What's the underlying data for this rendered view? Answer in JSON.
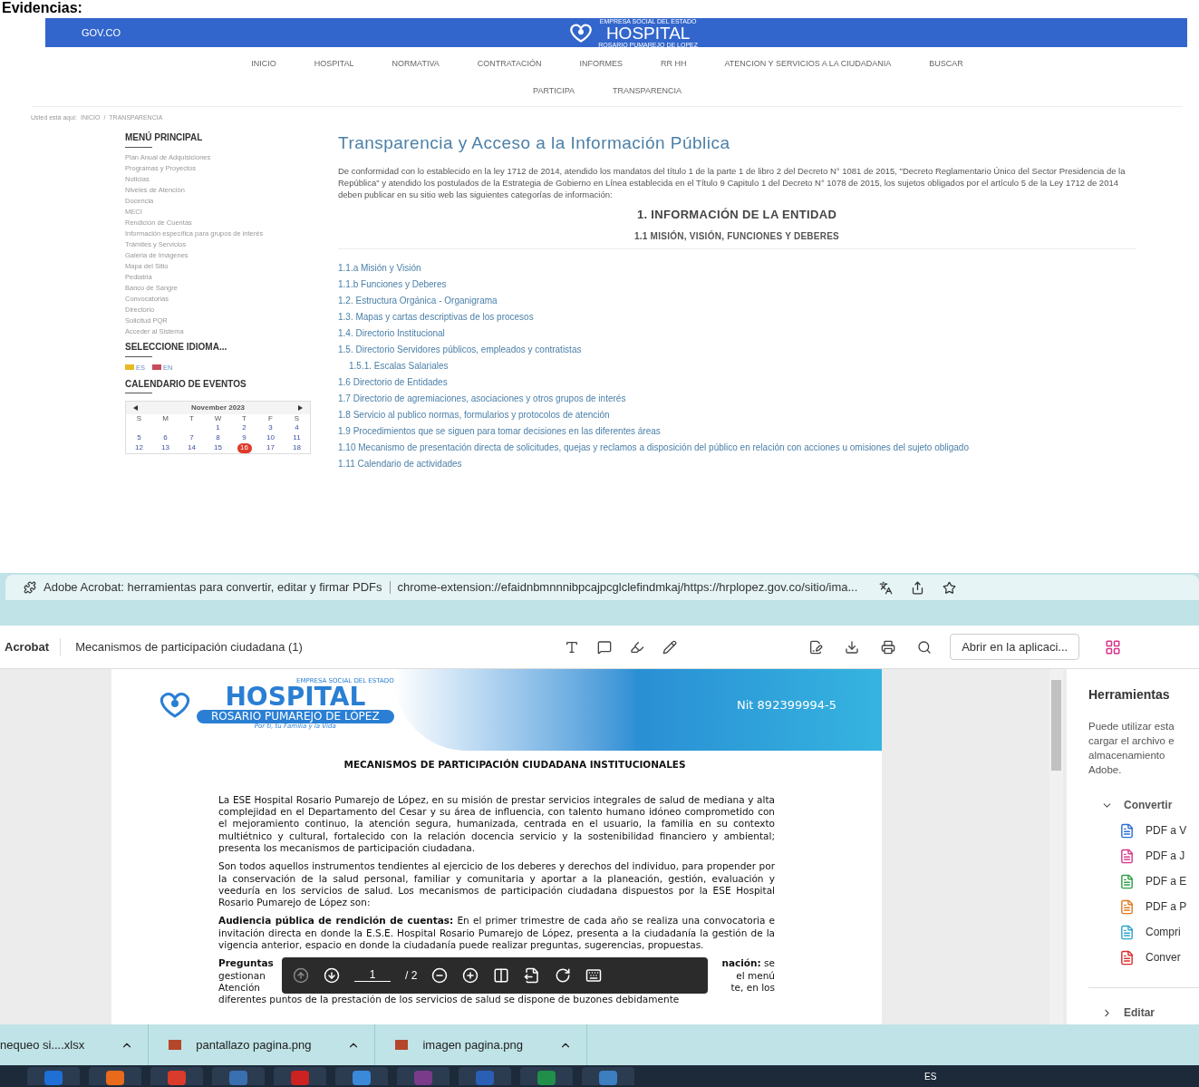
{
  "heading": "Evidencias:",
  "website": {
    "gov_label": "GOV.CO",
    "logo": {
      "top": "EMPRESA SOCIAL DEL ESTADO",
      "name": "HOSPITAL",
      "sub": "ROSARIO PUMAREJO DE LOPEZ"
    },
    "nav": [
      "INICIO",
      "HOSPITAL",
      "NORMATIVA",
      "CONTRATACIÓN",
      "INFORMES",
      "RR HH",
      "ATENCION Y SERVICIOS A LA CIUDADANIA",
      "BUSCAR",
      "PARTICIPA",
      "TRANSPARENCIA"
    ],
    "breadcrumb": {
      "prefix": "Usted está aquí:",
      "items": [
        "INICIO",
        "TRANSPARENCIA"
      ],
      "separator": "/"
    },
    "sidebar": {
      "menu_title": "MENÚ PRINCIPAL",
      "menu": [
        "Plan Anual de Adquisiciones",
        "Programas y Proyectos",
        "Noticias",
        "Niveles de Atención",
        "Docencia",
        "MECI",
        "Rendición de Cuentas",
        "Información específica para grupos de interés",
        "Trámites y Servicios",
        "Galeria de Imágenes",
        "Mapa del Sitio",
        "Pediatria",
        "Banco de Sangre",
        "Convocatorias",
        "Directorio",
        "Solicitud PQR",
        "Acceder al Sistema"
      ],
      "language_title": "SELECCIONE IDIOMA...",
      "languages": [
        "ES",
        "EN"
      ],
      "calendar_title": "CALENDARIO DE EVENTOS",
      "calendar": {
        "month": "November 2023",
        "weekdays": [
          "S",
          "M",
          "T",
          "W",
          "T",
          "F",
          "S"
        ],
        "weeks": [
          [
            {
              "day": "1",
              "today": false
            },
            {
              "day": "2",
              "today": false
            },
            {
              "day": "3",
              "today": false
            },
            {
              "day": "4",
              "today": false
            }
          ],
          [
            {
              "day": "5",
              "today": false
            },
            {
              "day": "6",
              "today": false
            },
            {
              "day": "7",
              "today": false
            },
            {
              "day": "8",
              "today": false
            },
            {
              "day": "9",
              "today": false
            },
            {
              "day": "10",
              "today": false
            },
            {
              "day": "11",
              "today": false
            }
          ],
          [
            {
              "day": "12",
              "today": false
            },
            {
              "day": "13",
              "today": false
            },
            {
              "day": "14",
              "today": false
            },
            {
              "day": "15",
              "today": false
            },
            {
              "day": "16",
              "today": true
            },
            {
              "day": "17",
              "today": false
            },
            {
              "day": "18",
              "today": false
            }
          ]
        ]
      }
    },
    "content": {
      "title": "Transparencia y Acceso a la Información Pública",
      "intro": "De conformidad con lo establecido en la ley 1712 de 2014, atendido los mandatos del título 1 de la parte 1 de libro 2 del Decreto N° 1081 de 2015, \"Decreto Reglamentario Único del Sector Presidencia de la República\" y atendido los postulados de la Estrategia de Gobierno en Línea establecida en el Título 9 Capitulo 1 del Decreto N° 1078 de 2015, los sujetos obligados por el artículo 5 de la Ley 1712 de 2014 deben publicar en su sitio web las siguientes categorías de información:",
      "section": "1. INFORMACIÓN DE LA ENTIDAD",
      "subsection": "1.1 MISIÓN, VISIÓN, FUNCIONES Y DEBERES",
      "links": [
        {
          "text": "1.1.a Misión y Visión"
        },
        {
          "text": "1.1.b Funciones y Deberes"
        },
        {
          "text": "1.2. Estructura Orgánica - Organigrama"
        },
        {
          "text": "1.3. Mapas y cartas descriptivas de los procesos"
        },
        {
          "text": "1.4. Directorio Institucional"
        },
        {
          "text": "1.5. Directorio Servidores públicos, empleados y contratistas",
          "children": [
            {
              "text": "1.5.1. Escalas Salariales"
            }
          ]
        },
        {
          "text": "1.6 Directorio de Entidades"
        },
        {
          "text": "1.7 Directorio de agremiaciones, asociaciones y otros grupos de interés"
        },
        {
          "text": "1.8 Servicio al publico normas, formularios y protocolos de atención"
        },
        {
          "text": "1.9 Procedimientos que se siguen para tomar decisiones en las diferentes áreas"
        },
        {
          "text": "1.10 Mecanismo de presentación directa de solicitudes, quejas y reclamos a disposición del público en relación con acciones u omisiones del sujeto obligado"
        },
        {
          "text": "1.11 Calendario de actividades"
        }
      ]
    }
  },
  "browser": {
    "tab_title": "Adobe Acrobat: herramientas para convertir, editar y firmar PDFs",
    "url": "chrome-extension://efaidnbmnnnibpcajpcglclefindmkaj/https://hrplopez.gov.co/sitio/ima...",
    "acrobat": {
      "brand": "Acrobat",
      "file_name": "Mecanismos de participación ciudadana (1)",
      "open_button": "Abrir en la aplicaci..."
    },
    "document": {
      "logo": {
        "top": "EMPRESA SOCIAL DEL ESTADO",
        "name": "HOSPITAL",
        "sub": "ROSARIO PUMAREJO DE LÓPEZ",
        "tagline": "Por ti, tu Familia y la Vida"
      },
      "nit": "Nit 892399994-5",
      "title": "MECANISMOS DE PARTICIPACIÓN CIUDADANA INSTITUCIONALES",
      "paragraphs": [
        "La ESE Hospital Rosario Pumarejo de López, en su misión de prestar servicios integrales de salud de mediana y alta complejidad en el Departamento del Cesar y su área de influencia, con talento humano idóneo comprometido con el mejoramiento continuo, la atención segura, humanizada, centrada en el usuario, la familia en su contexto multiétnico y cultural, fortalecido con la relación docencia servicio y la sostenibilidad financiero y ambiental; presenta los mecanismos de participación ciudadana.",
        "Son todos aquellos instrumentos tendientes al ejercicio de los deberes y derechos del individuo, para propender por la conservación de la salud personal, familiar y comunitaria y aportar a la planeación, gestión, evaluación y veeduría en los servicios de salud. Los mecanismos de participación ciudadana dispuestos por la ESE Hospital Rosario Pumarejo de López son:",
        "**Audiencia pública de rendición de cuentas:** En el primer trimestre de cada año se realiza una convocatoria e invitación directa en donde la E.S.E. Hospital Rosario Pumarejo de López, presenta a la ciudadanía la gestión de la vigencia anterior, espacio en donde la ciudadanía puede realizar preguntas, sugerencias, propuestas."
      ],
      "covered_lines": [
        {
          "left": "**Preguntas**",
          "right": "**nación:** se"
        },
        {
          "left": "gestionan",
          "right": "el menú"
        },
        {
          "left": "Atención",
          "right": "te, en los"
        }
      ],
      "last_line": "diferentes puntos de la prestación de los servicios de salud se dispone de buzones debidamente",
      "page_toolbar": {
        "page": "1",
        "total": "/ 2"
      }
    },
    "tools_panel": {
      "title": "Herramientas",
      "description": [
        "Puede utilizar esta",
        "cargar el archivo e",
        "almacenamiento",
        "Adobe."
      ],
      "sections": [
        {
          "label": "Convertir",
          "expanded": true,
          "items": [
            {
              "label": "PDF a V",
              "color": "#2b6fd6"
            },
            {
              "label": "PDF a J",
              "color": "#d6368a"
            },
            {
              "label": "PDF a E",
              "color": "#2e9e48"
            },
            {
              "label": "PDF a P",
              "color": "#e0781f"
            },
            {
              "label": "Compri",
              "color": "#2fa3c9"
            },
            {
              "label": "Conver",
              "color": "#dc2b2b"
            }
          ]
        },
        {
          "label": "Editar",
          "expanded": false
        }
      ]
    },
    "downloads": [
      "nequeo si....xlsx",
      "pantallazo pagina.png",
      "imagen pagina.png"
    ],
    "taskbar": {
      "language": "ES"
    }
  }
}
